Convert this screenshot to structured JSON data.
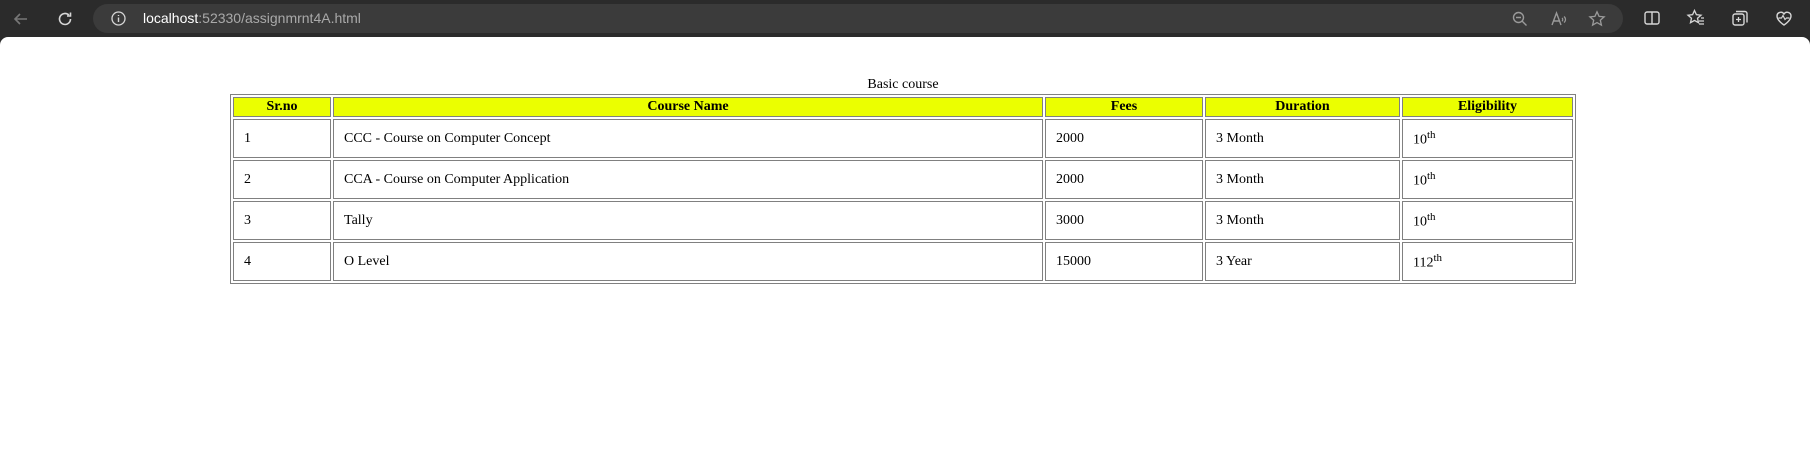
{
  "browser": {
    "url_host": "localhost",
    "url_rest": ":52330/assignmrnt4A.html"
  },
  "table": {
    "caption": "Basic course",
    "headers": [
      "Sr.no",
      "Course Name",
      "Fees",
      "Duration",
      "Eligibility"
    ],
    "rows": [
      {
        "sr": "1",
        "name": "CCC - Course on Computer Concept",
        "fees": "2000",
        "duration": "3 Month",
        "elig": "10",
        "elig_sup": "th"
      },
      {
        "sr": "2",
        "name": "CCA - Course on Computer Application",
        "fees": "2000",
        "duration": "3 Month",
        "elig": "10",
        "elig_sup": "th"
      },
      {
        "sr": "3",
        "name": "Tally",
        "fees": "3000",
        "duration": "3 Month",
        "elig": "10",
        "elig_sup": "th"
      },
      {
        "sr": "4",
        "name": "O Level",
        "fees": "15000",
        "duration": "3 Year",
        "elig": "112",
        "elig_sup": "th"
      }
    ]
  },
  "colors": {
    "header_background": "#ebff00",
    "chrome_background": "#2b2b2b"
  },
  "icons": [
    "back-icon",
    "refresh-icon",
    "info-icon",
    "zoom-out-icon",
    "read-aloud-icon",
    "favorite-star-icon",
    "split-screen-icon",
    "favorites-icon",
    "collections-icon",
    "browser-essentials-icon"
  ]
}
